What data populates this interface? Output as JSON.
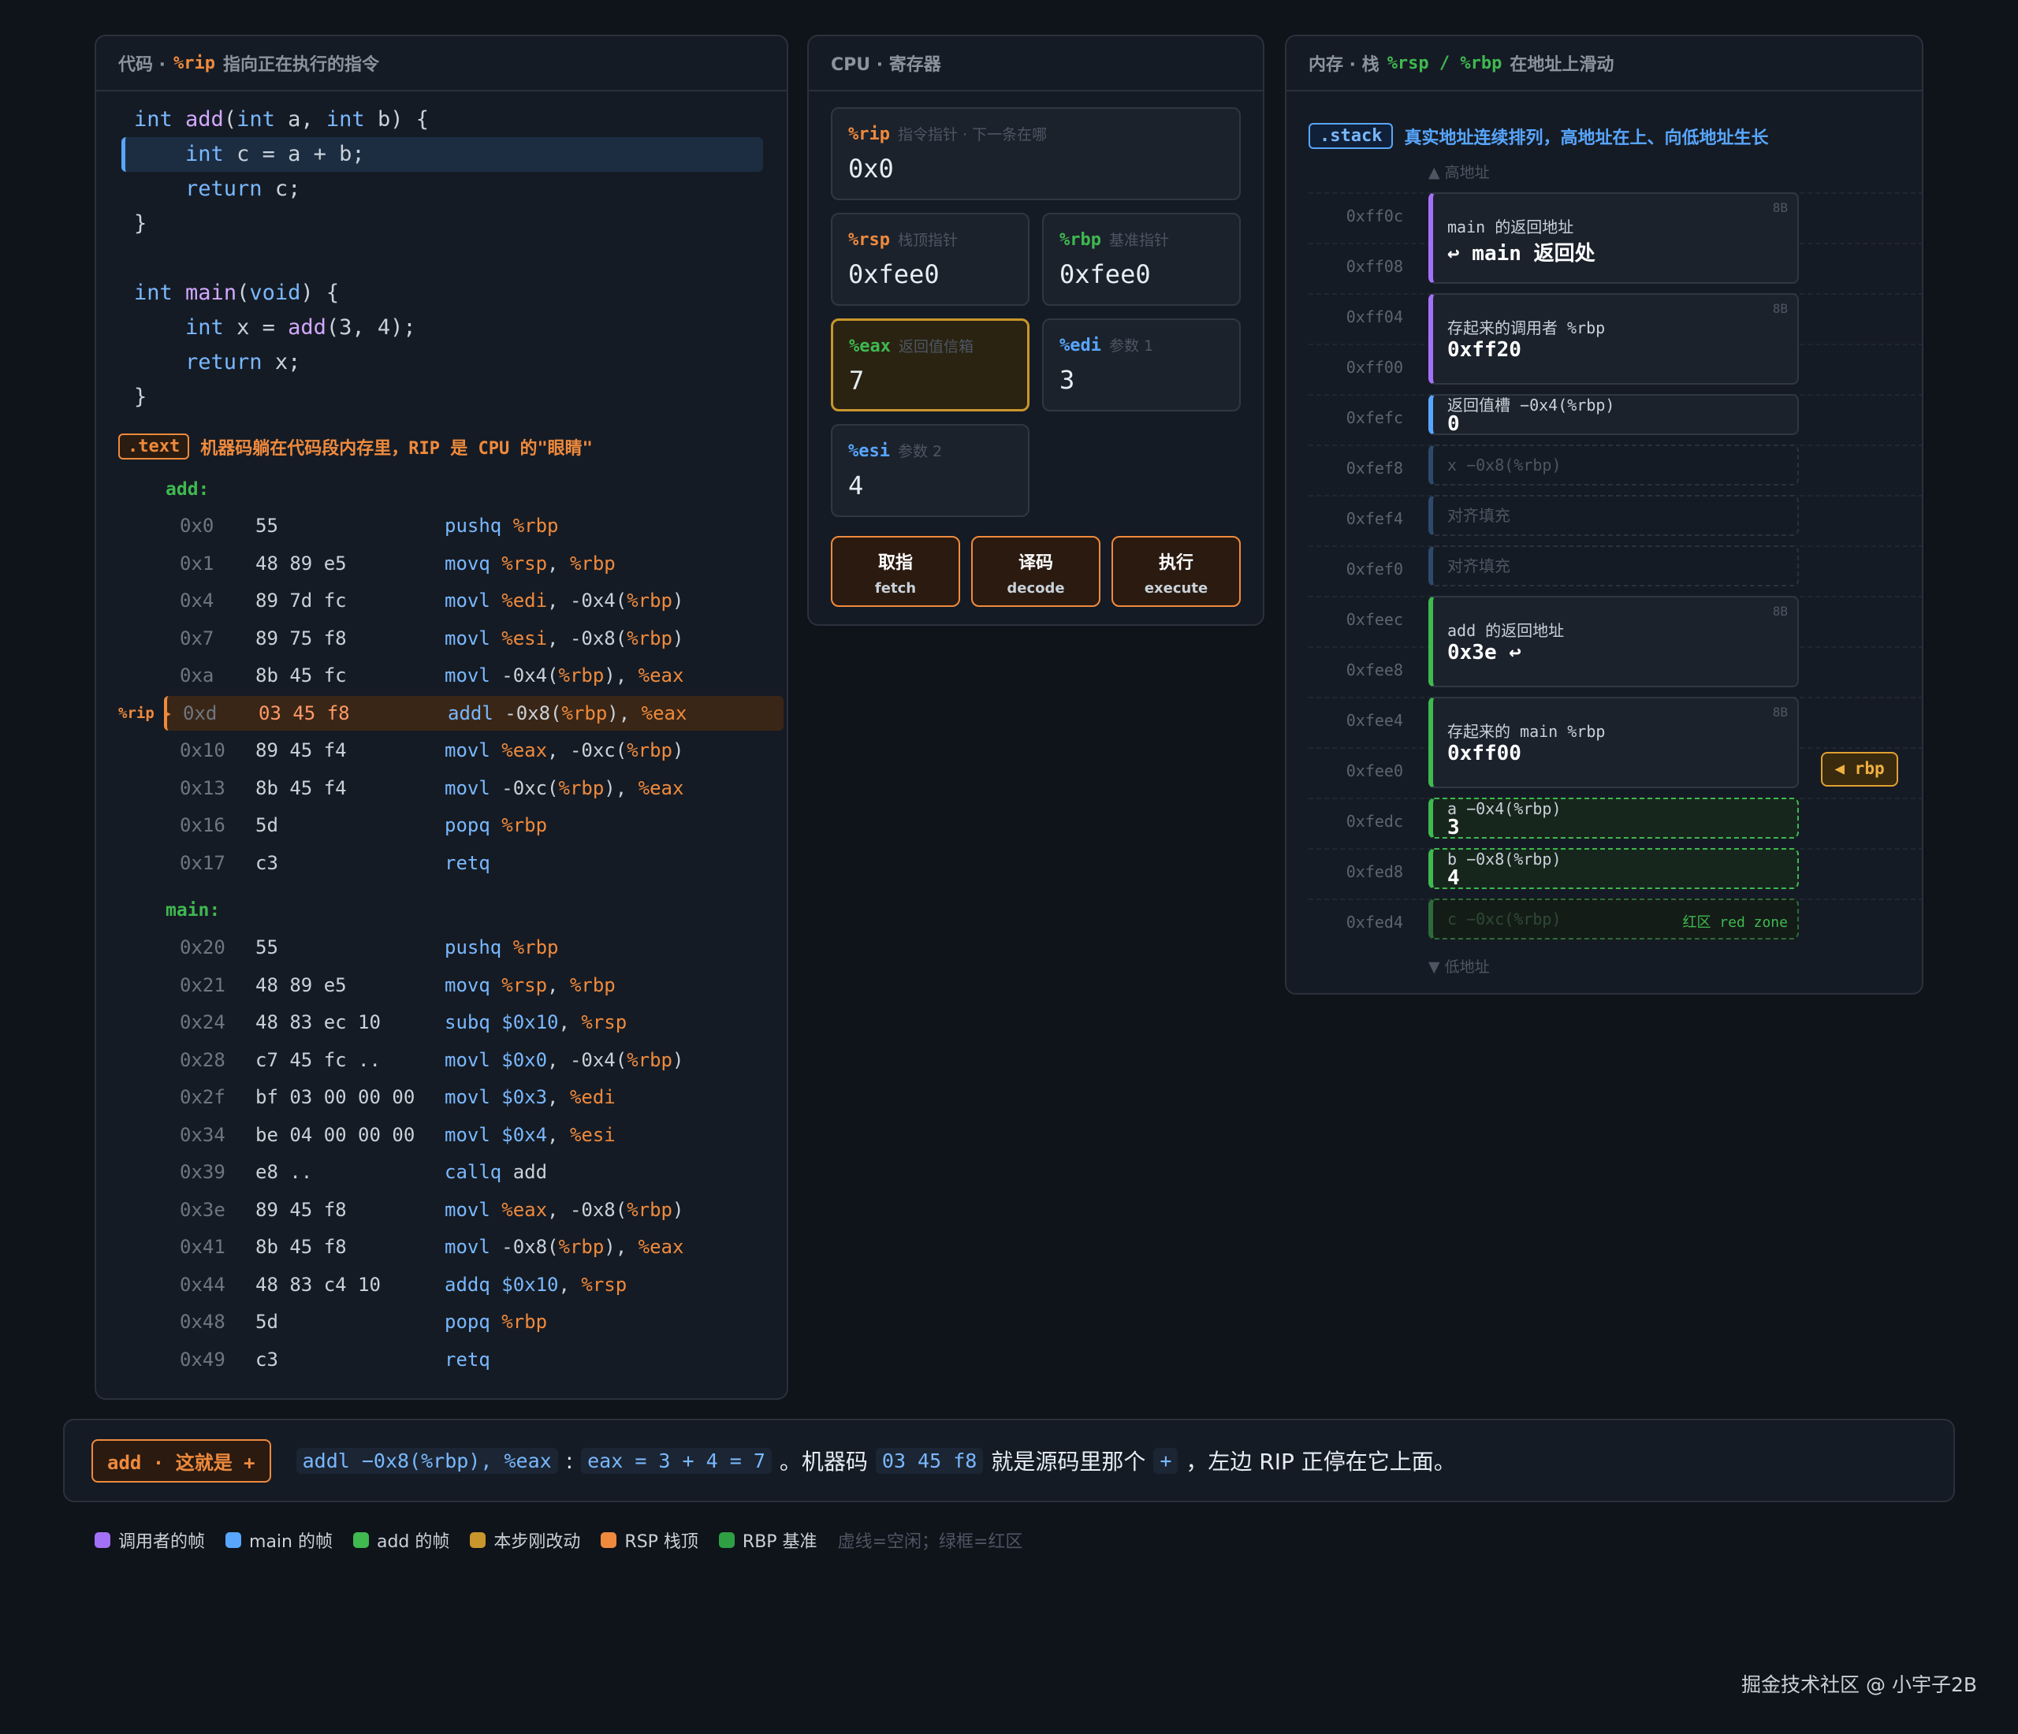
{
  "code_panel": {
    "title_prefix": "代码 ·",
    "title_reg": "%rip",
    "title_suffix": "指向正在执行的指令",
    "text_tag": ".text",
    "text_note": "机器码躺在代码段内存里，RIP 是 CPU 的\"眼睛\"",
    "add_label": "add:",
    "main_label": "main:",
    "rip_marker": "%rip ▸"
  },
  "asm_add": [
    {
      "addr": "0x0",
      "bytes": "55",
      "ins": "pushq %rbp"
    },
    {
      "addr": "0x1",
      "bytes": "48 89 e5",
      "ins": "movq %rsp, %rbp"
    },
    {
      "addr": "0x4",
      "bytes": "89 7d fc",
      "ins": "movl %edi, -0x4(%rbp)"
    },
    {
      "addr": "0x7",
      "bytes": "89 75 f8",
      "ins": "movl %esi, -0x8(%rbp)"
    },
    {
      "addr": "0xa",
      "bytes": "8b 45 fc",
      "ins": "movl -0x4(%rbp), %eax"
    },
    {
      "addr": "0xd",
      "bytes": "03 45 f8",
      "ins": "addl -0x8(%rbp), %eax"
    },
    {
      "addr": "0x10",
      "bytes": "89 45 f4",
      "ins": "movl %eax, -0xc(%rbp)"
    },
    {
      "addr": "0x13",
      "bytes": "8b 45 f4",
      "ins": "movl -0xc(%rbp), %eax"
    },
    {
      "addr": "0x16",
      "bytes": "5d",
      "ins": "popq %rbp"
    },
    {
      "addr": "0x17",
      "bytes": "c3",
      "ins": "retq"
    }
  ],
  "asm_main": [
    {
      "addr": "0x20",
      "bytes": "55",
      "ins": "pushq %rbp"
    },
    {
      "addr": "0x21",
      "bytes": "48 89 e5",
      "ins": "movq %rsp, %rbp"
    },
    {
      "addr": "0x24",
      "bytes": "48 83 ec 10",
      "ins": "subq $0x10, %rsp"
    },
    {
      "addr": "0x28",
      "bytes": "c7 45 fc ..",
      "ins": "movl $0x0, -0x4(%rbp)"
    },
    {
      "addr": "0x2f",
      "bytes": "bf 03 00 00 00",
      "ins": "movl $0x3, %edi"
    },
    {
      "addr": "0x34",
      "bytes": "be 04 00 00 00",
      "ins": "movl $0x4, %esi"
    },
    {
      "addr": "0x39",
      "bytes": "e8 ..",
      "ins": "callq add"
    },
    {
      "addr": "0x3e",
      "bytes": "89 45 f8",
      "ins": "movl %eax, -0x8(%rbp)"
    },
    {
      "addr": "0x41",
      "bytes": "8b 45 f8",
      "ins": "movl -0x8(%rbp), %eax"
    },
    {
      "addr": "0x44",
      "bytes": "48 83 c4 10",
      "ins": "addq $0x10, %rsp"
    },
    {
      "addr": "0x48",
      "bytes": "5d",
      "ins": "popq %rbp"
    },
    {
      "addr": "0x49",
      "bytes": "c3",
      "ins": "retq"
    }
  ],
  "cpu": {
    "title": "CPU · 寄存器",
    "rip": {
      "name": "%rip",
      "desc": "指令指针 · 下一条在哪",
      "value": "0x0"
    },
    "rsp": {
      "name": "%rsp",
      "desc": "栈顶指针",
      "value": "0xfee0"
    },
    "rbp": {
      "name": "%rbp",
      "desc": "基准指针",
      "value": "0xfee0"
    },
    "eax": {
      "name": "%eax",
      "desc": "返回值信箱",
      "value": "7"
    },
    "edi": {
      "name": "%edi",
      "desc": "参数 1",
      "value": "3"
    },
    "esi": {
      "name": "%esi",
      "desc": "参数 2",
      "value": "4"
    },
    "fetch": {
      "zh": "取指",
      "en": "fetch"
    },
    "decode": {
      "zh": "译码",
      "en": "decode"
    },
    "execute": {
      "zh": "执行",
      "en": "execute"
    }
  },
  "memory": {
    "title_prefix": "内存 · 栈",
    "title_regs": "%rsp / %rbp",
    "title_suffix": "在地址上滑动",
    "stack_tag": ".stack",
    "stack_note": "真实地址连续排列，高地址在上、向低地址生长",
    "high": "▲ 高地址",
    "low": "▼ 低地址",
    "addresses": [
      "0xff0c",
      "0xff08",
      "0xff04",
      "0xff00",
      "0xfefc",
      "0xfef8",
      "0xfef4",
      "0xfef0",
      "0xfeec",
      "0xfee8",
      "0xfee4",
      "0xfee0",
      "0xfedc",
      "0xfed8",
      "0xfed4"
    ],
    "slots": {
      "main_ret": {
        "label": "main 的返回地址",
        "value": "↩ main 返回处",
        "size": "8B"
      },
      "saved_rbp": {
        "label": "存起来的调用者 %rbp",
        "value": "0xff20",
        "size": "8B"
      },
      "ret_slot": {
        "label": "返回值槽 −0x4(%rbp)",
        "value": "0"
      },
      "x": {
        "label": "x −0x8(%rbp)"
      },
      "pad1": {
        "label": "对齐填充"
      },
      "pad2": {
        "label": "对齐填充"
      },
      "add_ret": {
        "label": "add 的返回地址",
        "value": "0x3e ↩",
        "size": "8B"
      },
      "main_rbp": {
        "label": "存起来的 main %rbp",
        "value": "0xff00",
        "size": "8B"
      },
      "a": {
        "label": "a −0x4(%rbp)",
        "value": "3"
      },
      "b": {
        "label": "b −0x8(%rbp)",
        "value": "4"
      },
      "c": {
        "label": "c −0xc(%rbp)",
        "zone": "红区 red zone"
      }
    },
    "rbp_tag": "◀ rbp"
  },
  "explain": {
    "badge": "add · 这就是 +",
    "chip1": "addl −0x8(%rbp), %eax",
    "colon": ":",
    "chip2": "eax = 3 + 4 = 7",
    "t1": "。机器码",
    "chip3": "03 45 f8",
    "t2": "就是源码里那个",
    "chip4": "+",
    "t3": "，左边 RIP 正停在它上面。"
  },
  "legend": [
    {
      "label": "调用者的帧",
      "color": "#a371f7"
    },
    {
      "label": "main 的帧",
      "color": "#58a6ff"
    },
    {
      "label": "add 的帧",
      "color": "#3fb950"
    },
    {
      "label": "本步刚改动",
      "color": "#c9962b"
    },
    {
      "label": "RSP 栈顶",
      "color": "#ef8a3d"
    },
    {
      "label": "RBP 基准",
      "color": "#2ea043"
    }
  ],
  "legend_note": "虚线=空闲；绿框=红区",
  "footer": "掘金技术社区 @ 小宇子2B"
}
